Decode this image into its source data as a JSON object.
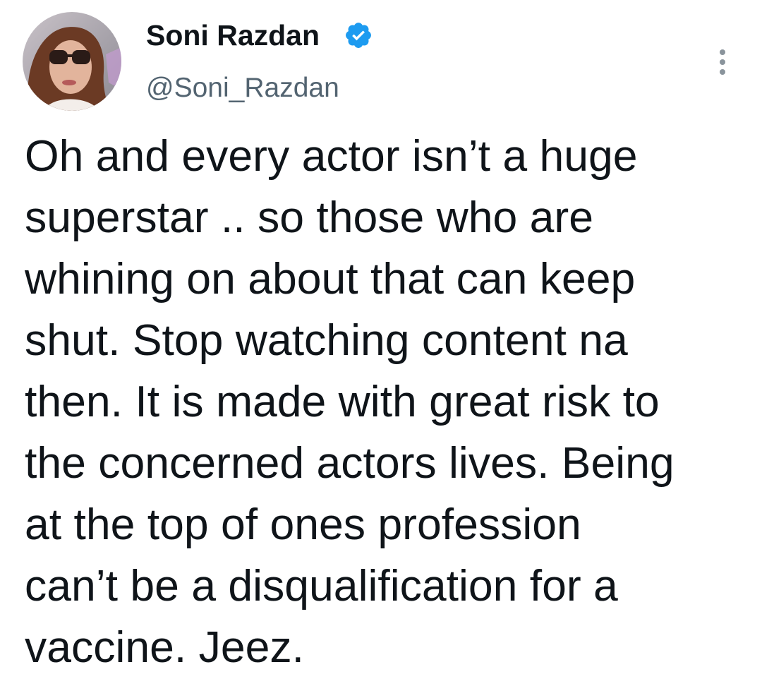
{
  "author": {
    "display_name": "Soni Razdan",
    "handle": "@Soni_Razdan",
    "verified": true,
    "verified_icon": "verified-badge-icon",
    "avatar_icon": "profile-photo"
  },
  "menu": {
    "icon": "more-options-icon"
  },
  "tweet": {
    "lines": [
      "Oh and every actor isn’t a huge",
      "superstar .. so those who are",
      "whining on about that can keep",
      "shut. Stop watching content na",
      "then. It is made with great risk to",
      "the concerned actors lives. Being",
      "at the top of ones profession",
      "can’t be a disqualification for a",
      "vaccine. Jeez."
    ]
  },
  "colors": {
    "text_primary": "#0f1419",
    "text_secondary": "#536471",
    "verified_blue": "#1d9bf0",
    "background": "#ffffff"
  }
}
